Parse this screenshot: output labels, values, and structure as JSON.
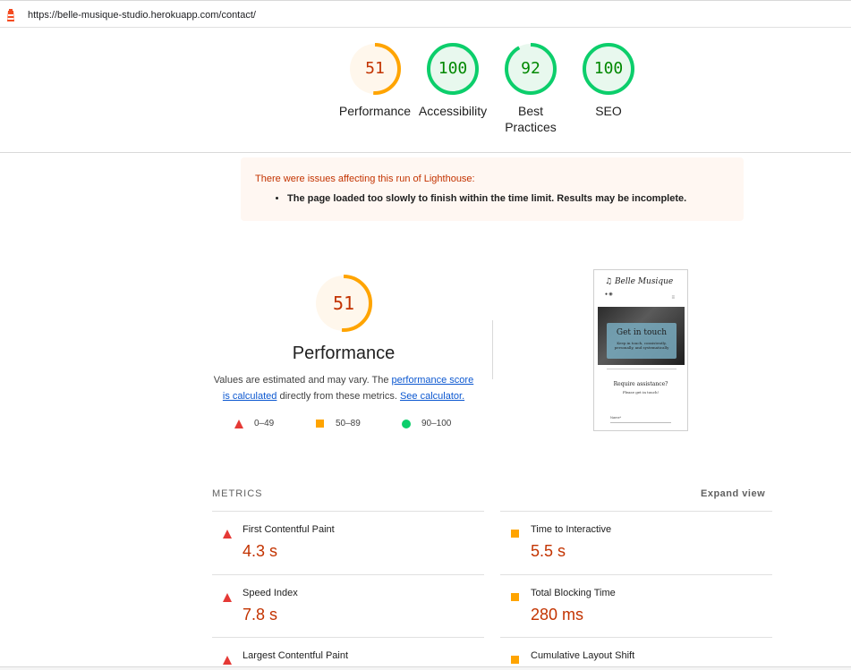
{
  "urlbar": {
    "url": "https://belle-musique-studio.herokuapp.com/contact/"
  },
  "gauges": [
    {
      "label": "Performance",
      "score": "51",
      "fraction": 0.51,
      "rating": "average",
      "color": "#ffa400"
    },
    {
      "label": "Accessibility",
      "score": "100",
      "fraction": 1.0,
      "rating": "pass",
      "color": "#0cce6b"
    },
    {
      "label": "Best Practices",
      "score": "92",
      "fraction": 0.92,
      "rating": "pass",
      "color": "#0cce6b"
    },
    {
      "label": "SEO",
      "score": "100",
      "fraction": 1.0,
      "rating": "pass",
      "color": "#0cce6b"
    }
  ],
  "warning": {
    "title": "There were issues affecting this run of Lighthouse:",
    "items": [
      "The page loaded too slowly to finish within the time limit. Results may be incomplete."
    ]
  },
  "performance": {
    "score": "51",
    "fraction": 0.51,
    "title": "Performance",
    "desc_prefix": "Values are estimated and may vary. The ",
    "desc_link1": "performance score is calculated",
    "desc_middle": " directly from these metrics. ",
    "desc_link2": "See calculator."
  },
  "legend": [
    {
      "range": "0–49",
      "shape": "triangle",
      "color": "#e53935"
    },
    {
      "range": "50–89",
      "shape": "square",
      "color": "#ffa400"
    },
    {
      "range": "90–100",
      "shape": "circle",
      "color": "#0cce6b"
    }
  ],
  "thumbnail": {
    "brand": "Belle Musique",
    "hero_title": "Get in touch",
    "hero_sub": "Keep in touch, consistently, personally, and systematically",
    "assist": "Require assistance?",
    "please": "Please get in touch!",
    "name_label": "Name*"
  },
  "metrics": {
    "header": "METRICS",
    "expand_label": "Expand view",
    "items": [
      {
        "title": "First Contentful Paint",
        "value": "4.3 s",
        "rating": "fail"
      },
      {
        "title": "Time to Interactive",
        "value": "5.5 s",
        "rating": "average"
      },
      {
        "title": "Speed Index",
        "value": "7.8 s",
        "rating": "fail"
      },
      {
        "title": "Total Blocking Time",
        "value": "280 ms",
        "rating": "average"
      },
      {
        "title": "Largest Contentful Paint",
        "value": "",
        "rating": "fail"
      },
      {
        "title": "Cumulative Layout Shift",
        "value": "",
        "rating": "average"
      }
    ]
  },
  "colors": {
    "fail": "#e53935",
    "average": "#ffa400",
    "pass": "#0cce6b",
    "fail_text": "#c33300",
    "pass_text": "#008800"
  }
}
